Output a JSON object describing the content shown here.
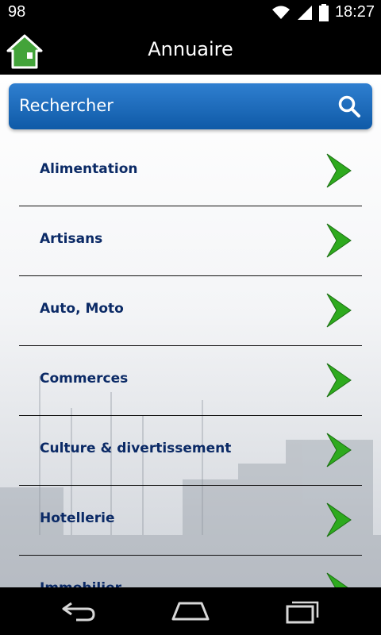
{
  "status_bar": {
    "notification_count": "98",
    "time": "18:27",
    "icons": [
      "wifi-icon",
      "signal-icon",
      "battery-icon"
    ]
  },
  "header": {
    "title": "Annuaire",
    "home_icon": "home-icon"
  },
  "search": {
    "label": "Rechercher",
    "icon": "search-icon"
  },
  "list": {
    "items": [
      {
        "label": "Alimentation"
      },
      {
        "label": "Artisans"
      },
      {
        "label": "Auto, Moto"
      },
      {
        "label": "Commerces"
      },
      {
        "label": "Culture & divertissement"
      },
      {
        "label": "Hotellerie"
      },
      {
        "label": "Immobilier"
      }
    ]
  },
  "nav_bar": {
    "icons": [
      "back-icon",
      "home-icon",
      "recent-apps-icon"
    ]
  },
  "colors": {
    "accent": "#1a69bb",
    "item_text": "#0b2a66",
    "arrow": "#2eaa1e"
  }
}
